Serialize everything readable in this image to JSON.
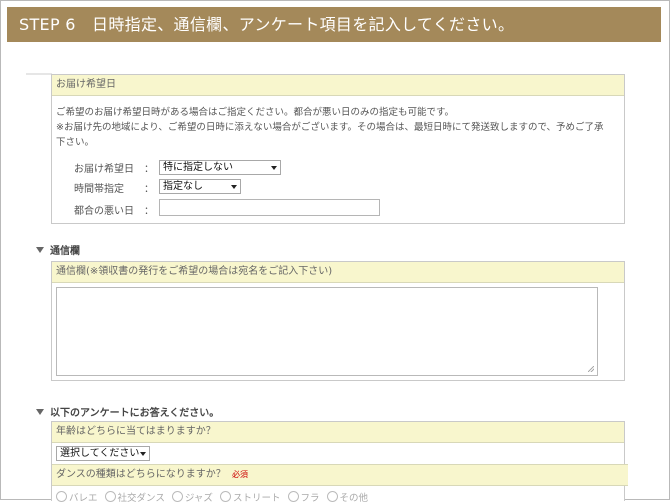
{
  "step_banner": "STEP 6　日時指定、通信欄、アンケート項目を記入してください。",
  "delivery": {
    "title": "お届け希望日",
    "desc_line1": "ご希望のお届け希望日時がある場合はご指定ください。都合が悪い日のみの指定も可能です。",
    "desc_line2": "※お届け先の地域により、ご希望の日時に添えない場合がございます。その場合は、最短日時にて発送致しますので、予めご了承",
    "desc_line3": "下さい。",
    "date_label": "お届け希望日　：",
    "date_value": "特に指定しない",
    "time_label": "時間帯指定　　：",
    "time_value": "指定なし",
    "bad_day_label": "都合の悪い日　：",
    "bad_day_value": ""
  },
  "message": {
    "section_title": "通信欄",
    "box_title": "通信欄(※領収書の発行をご希望の場合は宛名をご記入下さい)",
    "textarea_value": ""
  },
  "survey": {
    "section_title": "以下のアンケートにお答えください。",
    "q1": "年齢はどちらに当てはまりますか？",
    "q1_value": "選択してください",
    "q2": "ダンスの種類はどちらになりますか？",
    "q2_required": "必須",
    "q2_options": [
      "バレエ",
      "社交ダンス",
      "ジャズ",
      "ストリート",
      "フラ",
      "その他"
    ]
  },
  "colors": {
    "banner": "#a4895a",
    "header_bg": "#f8f6cd",
    "required": "#cc0000"
  }
}
